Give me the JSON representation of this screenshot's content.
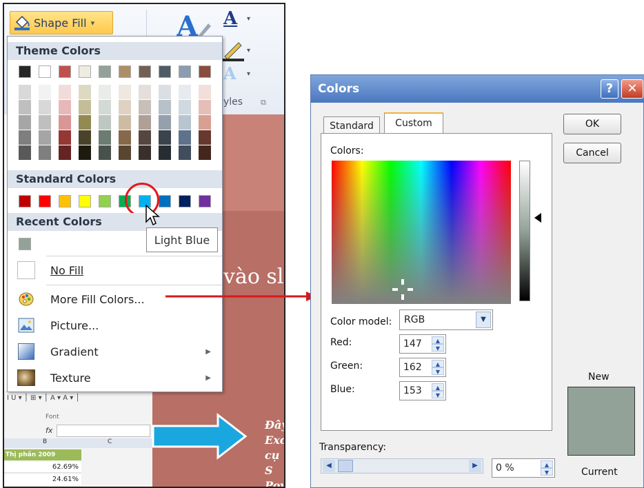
{
  "left_panel": {
    "shape_fill_button": {
      "label": "Shape Fill",
      "icon": "paint-bucket-icon",
      "caret": "▾"
    },
    "ribbon": {
      "wordart_icon": "wordart-style-icon",
      "text_fill_glyph": "A",
      "text_outline_glyph": "A",
      "text_effects_glyph": "A",
      "group_caption": "yles"
    },
    "menu": {
      "theme_colors_title": "Theme Colors",
      "standard_colors_title": "Standard Colors",
      "recent_colors_title": "Recent Colors",
      "theme_columns": [
        {
          "base": "#262626",
          "tints": [
            "#d9d9d9",
            "#bfbfbf",
            "#a6a6a6",
            "#7f7f7f",
            "#595959"
          ]
        },
        {
          "base": "#ffffff",
          "tints": [
            "#f2f2f2",
            "#d8d8d8",
            "#bfbfbf",
            "#a5a5a5",
            "#7f7f7f"
          ]
        },
        {
          "base": "#c0504d",
          "tints": [
            "#f2dcdb",
            "#e6b9b8",
            "#d99694",
            "#953734",
            "#632423"
          ]
        },
        {
          "base": "#eeece1",
          "tints": [
            "#ddd9c3",
            "#c4bd97",
            "#938953",
            "#494429",
            "#1d1b10"
          ]
        },
        {
          "base": "#93a299",
          "tints": [
            "#e9ece9",
            "#d3d9d5",
            "#bec7c2",
            "#6d7c72",
            "#48524c"
          ]
        },
        {
          "base": "#ad8f67",
          "tints": [
            "#efe8e0",
            "#dfd2c2",
            "#cebba3",
            "#86694a",
            "#594631"
          ]
        },
        {
          "base": "#726056",
          "tints": [
            "#e4dfdc",
            "#c9bfb9",
            "#af9f96",
            "#554740",
            "#392f2b"
          ]
        },
        {
          "base": "#4f5b66",
          "tints": [
            "#dbdfe3",
            "#b8c0c8",
            "#94a0ac",
            "#3b444c",
            "#272d33"
          ]
        },
        {
          "base": "#8a9db1",
          "tints": [
            "#e7ebef",
            "#d0d8e0",
            "#b8c4d0",
            "#5e738b",
            "#3f4d5c"
          ]
        },
        {
          "base": "#8b4d3e",
          "tints": [
            "#f2dfdb",
            "#e5bfb7",
            "#d89f93",
            "#67392e",
            "#45261f"
          ]
        }
      ],
      "standard_colors": [
        "#c00000",
        "#ff0000",
        "#ffc000",
        "#ffff00",
        "#92d050",
        "#00b050",
        "#00b0f0",
        "#0070c0",
        "#002060",
        "#7030a0"
      ],
      "recent_colors": [
        "#93a299"
      ],
      "tooltip": "Light Blue",
      "items": [
        {
          "key": "no_fill",
          "label": "No Fill",
          "icon": "no-fill-icon",
          "submenu": false
        },
        {
          "key": "more_fill_colors",
          "label": "More Fill Colors...",
          "icon": "color-palette-icon",
          "submenu": false
        },
        {
          "key": "picture",
          "label": "Picture...",
          "icon": "picture-icon",
          "submenu": true
        },
        {
          "key": "gradient",
          "label": "Gradient",
          "icon": "gradient-icon",
          "submenu": true
        },
        {
          "key": "texture",
          "label": "Texture",
          "icon": "texture-icon",
          "submenu": true
        }
      ]
    },
    "slide": {
      "visible_text": "vào sl",
      "italic_lines": [
        "Đây",
        "Exc",
        "cụ S",
        "Pov"
      ]
    },
    "excel": {
      "header_cell": "Thị phần 2009",
      "cells": [
        "62.69%",
        "24.61%"
      ],
      "col_letters": [
        "B",
        "C"
      ],
      "font_group": "Font"
    }
  },
  "dialog": {
    "title": "Colors",
    "help_glyph": "?",
    "close_glyph": "✕",
    "tabs": [
      {
        "label": "Standard",
        "active": false
      },
      {
        "label": "Custom",
        "active": true
      }
    ],
    "ok_label": "OK",
    "cancel_label": "Cancel",
    "colors_label": "Colors:",
    "color_model_label": "Color model:",
    "color_model_value": "RGB",
    "red_label": "Red:",
    "red_value": "147",
    "green_label": "Green:",
    "green_value": "162",
    "blue_label": "Blue:",
    "blue_value": "153",
    "transparency_label": "Transparency:",
    "transparency_value": "0 %",
    "new_label": "New",
    "current_label": "Current",
    "new_color": "#93a299",
    "current_color": "#93a299"
  }
}
